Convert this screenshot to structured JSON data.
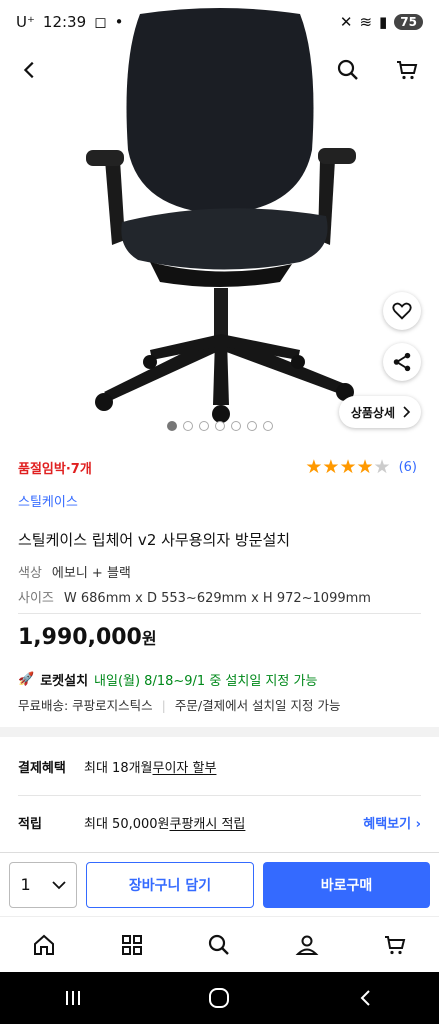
{
  "status": {
    "carrier": "U⁺",
    "time": "12:39",
    "battery": "75"
  },
  "hero": {
    "detail_label": "상품상세",
    "image_count": 7,
    "active_index": 1
  },
  "product": {
    "stock_badge": "품절임박·7개",
    "rating": 4,
    "review_count": "(6)",
    "brand": "스틸케이스",
    "title": "스틸케이스 립체어 v2 사무용의자 방문설치",
    "color_key": "색상",
    "color_value": "에보니 + 블랙",
    "size_key": "사이즈",
    "size_value": "W 686mm x D 553~629mm x H 972~1099mm",
    "price": "1,990,000",
    "price_unit": "원"
  },
  "delivery": {
    "rocket_label": "로켓설치",
    "rocket_date": "내일(월) 8/18~9/1 중 설치일 지정 가능",
    "free_ship": "무료배송: 쿠팡로지스틱스",
    "ship_note": "주문/결제에서 설치일 지정 가능"
  },
  "benefits": {
    "payment_label": "결제혜택",
    "payment_text": "최대 18개월 ",
    "payment_link": "무이자 할부",
    "points_label": "적립",
    "points_text": "최대 50,000원 ",
    "points_link": "쿠팡캐시 적립",
    "more_label": "혜택보기"
  },
  "actions": {
    "quantity": "1",
    "cart_label": "장바구니 담기",
    "buy_label": "바로구매"
  },
  "colors": {
    "accent": "#346aff",
    "red": "#e02020",
    "green": "#00891a",
    "star": "#ff9900"
  }
}
